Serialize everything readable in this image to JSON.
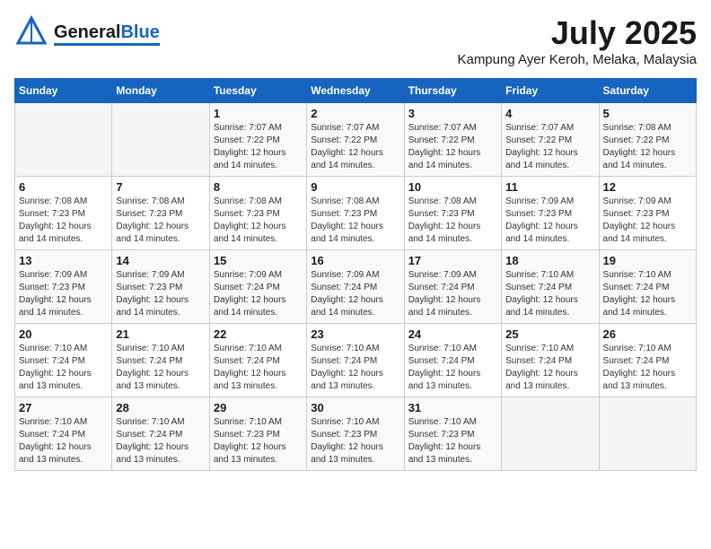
{
  "header": {
    "logo_general": "General",
    "logo_blue": "Blue",
    "month_year": "July 2025",
    "location": "Kampung Ayer Keroh, Melaka, Malaysia"
  },
  "calendar": {
    "days_of_week": [
      "Sunday",
      "Monday",
      "Tuesday",
      "Wednesday",
      "Thursday",
      "Friday",
      "Saturday"
    ],
    "weeks": [
      [
        {
          "day": "",
          "info": ""
        },
        {
          "day": "",
          "info": ""
        },
        {
          "day": "1",
          "info": "Sunrise: 7:07 AM\nSunset: 7:22 PM\nDaylight: 12 hours and 14 minutes."
        },
        {
          "day": "2",
          "info": "Sunrise: 7:07 AM\nSunset: 7:22 PM\nDaylight: 12 hours and 14 minutes."
        },
        {
          "day": "3",
          "info": "Sunrise: 7:07 AM\nSunset: 7:22 PM\nDaylight: 12 hours and 14 minutes."
        },
        {
          "day": "4",
          "info": "Sunrise: 7:07 AM\nSunset: 7:22 PM\nDaylight: 12 hours and 14 minutes."
        },
        {
          "day": "5",
          "info": "Sunrise: 7:08 AM\nSunset: 7:22 PM\nDaylight: 12 hours and 14 minutes."
        }
      ],
      [
        {
          "day": "6",
          "info": "Sunrise: 7:08 AM\nSunset: 7:23 PM\nDaylight: 12 hours and 14 minutes."
        },
        {
          "day": "7",
          "info": "Sunrise: 7:08 AM\nSunset: 7:23 PM\nDaylight: 12 hours and 14 minutes."
        },
        {
          "day": "8",
          "info": "Sunrise: 7:08 AM\nSunset: 7:23 PM\nDaylight: 12 hours and 14 minutes."
        },
        {
          "day": "9",
          "info": "Sunrise: 7:08 AM\nSunset: 7:23 PM\nDaylight: 12 hours and 14 minutes."
        },
        {
          "day": "10",
          "info": "Sunrise: 7:08 AM\nSunset: 7:23 PM\nDaylight: 12 hours and 14 minutes."
        },
        {
          "day": "11",
          "info": "Sunrise: 7:09 AM\nSunset: 7:23 PM\nDaylight: 12 hours and 14 minutes."
        },
        {
          "day": "12",
          "info": "Sunrise: 7:09 AM\nSunset: 7:23 PM\nDaylight: 12 hours and 14 minutes."
        }
      ],
      [
        {
          "day": "13",
          "info": "Sunrise: 7:09 AM\nSunset: 7:23 PM\nDaylight: 12 hours and 14 minutes."
        },
        {
          "day": "14",
          "info": "Sunrise: 7:09 AM\nSunset: 7:23 PM\nDaylight: 12 hours and 14 minutes."
        },
        {
          "day": "15",
          "info": "Sunrise: 7:09 AM\nSunset: 7:24 PM\nDaylight: 12 hours and 14 minutes."
        },
        {
          "day": "16",
          "info": "Sunrise: 7:09 AM\nSunset: 7:24 PM\nDaylight: 12 hours and 14 minutes."
        },
        {
          "day": "17",
          "info": "Sunrise: 7:09 AM\nSunset: 7:24 PM\nDaylight: 12 hours and 14 minutes."
        },
        {
          "day": "18",
          "info": "Sunrise: 7:10 AM\nSunset: 7:24 PM\nDaylight: 12 hours and 14 minutes."
        },
        {
          "day": "19",
          "info": "Sunrise: 7:10 AM\nSunset: 7:24 PM\nDaylight: 12 hours and 14 minutes."
        }
      ],
      [
        {
          "day": "20",
          "info": "Sunrise: 7:10 AM\nSunset: 7:24 PM\nDaylight: 12 hours and 13 minutes."
        },
        {
          "day": "21",
          "info": "Sunrise: 7:10 AM\nSunset: 7:24 PM\nDaylight: 12 hours and 13 minutes."
        },
        {
          "day": "22",
          "info": "Sunrise: 7:10 AM\nSunset: 7:24 PM\nDaylight: 12 hours and 13 minutes."
        },
        {
          "day": "23",
          "info": "Sunrise: 7:10 AM\nSunset: 7:24 PM\nDaylight: 12 hours and 13 minutes."
        },
        {
          "day": "24",
          "info": "Sunrise: 7:10 AM\nSunset: 7:24 PM\nDaylight: 12 hours and 13 minutes."
        },
        {
          "day": "25",
          "info": "Sunrise: 7:10 AM\nSunset: 7:24 PM\nDaylight: 12 hours and 13 minutes."
        },
        {
          "day": "26",
          "info": "Sunrise: 7:10 AM\nSunset: 7:24 PM\nDaylight: 12 hours and 13 minutes."
        }
      ],
      [
        {
          "day": "27",
          "info": "Sunrise: 7:10 AM\nSunset: 7:24 PM\nDaylight: 12 hours and 13 minutes."
        },
        {
          "day": "28",
          "info": "Sunrise: 7:10 AM\nSunset: 7:24 PM\nDaylight: 12 hours and 13 minutes."
        },
        {
          "day": "29",
          "info": "Sunrise: 7:10 AM\nSunset: 7:23 PM\nDaylight: 12 hours and 13 minutes."
        },
        {
          "day": "30",
          "info": "Sunrise: 7:10 AM\nSunset: 7:23 PM\nDaylight: 12 hours and 13 minutes."
        },
        {
          "day": "31",
          "info": "Sunrise: 7:10 AM\nSunset: 7:23 PM\nDaylight: 12 hours and 13 minutes."
        },
        {
          "day": "",
          "info": ""
        },
        {
          "day": "",
          "info": ""
        }
      ]
    ]
  }
}
